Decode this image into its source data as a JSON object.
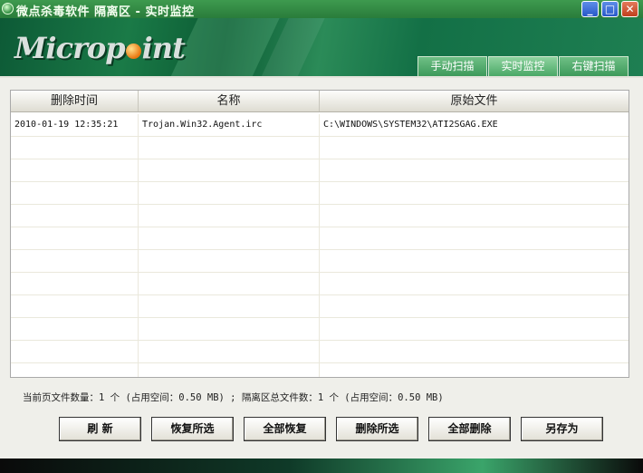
{
  "window": {
    "title": "微点杀毒软件 隔离区 - 实时监控",
    "buttons": {
      "minimize": "_",
      "maximize": "□",
      "close": "✕"
    }
  },
  "header": {
    "logo": {
      "part1": "Microp",
      "part2": "int"
    },
    "tabs": [
      "手动扫描",
      "实时监控",
      "右键扫描"
    ],
    "active_tab": "实时监控"
  },
  "table": {
    "columns": [
      "删除时间",
      "名称",
      "原始文件"
    ],
    "rows": [
      [
        "2010-01-19 12:35:21",
        "Trojan.Win32.Agent.irc",
        "C:\\WINDOWS\\SYSTEM32\\ATI2SGAG.EXE"
      ],
      [
        "",
        "",
        ""
      ],
      [
        "",
        "",
        ""
      ],
      [
        "",
        "",
        ""
      ],
      [
        "",
        "",
        ""
      ],
      [
        "",
        "",
        ""
      ],
      [
        "",
        "",
        ""
      ],
      [
        "",
        "",
        ""
      ],
      [
        "",
        "",
        ""
      ],
      [
        "",
        "",
        ""
      ],
      [
        "",
        "",
        ""
      ],
      [
        "",
        "",
        ""
      ]
    ]
  },
  "status_text": "当前页文件数量：1 个 (占用空间：0.50 MB) ; 隔离区总文件数：1 个 (占用空间：0.50 MB)",
  "actions": [
    "刷 新",
    "恢复所选",
    "全部恢复",
    "删除所选",
    "全部删除",
    "另存为"
  ],
  "colors": {
    "brand_green": "#1a7a47",
    "title_green": "#2a7c3b"
  }
}
